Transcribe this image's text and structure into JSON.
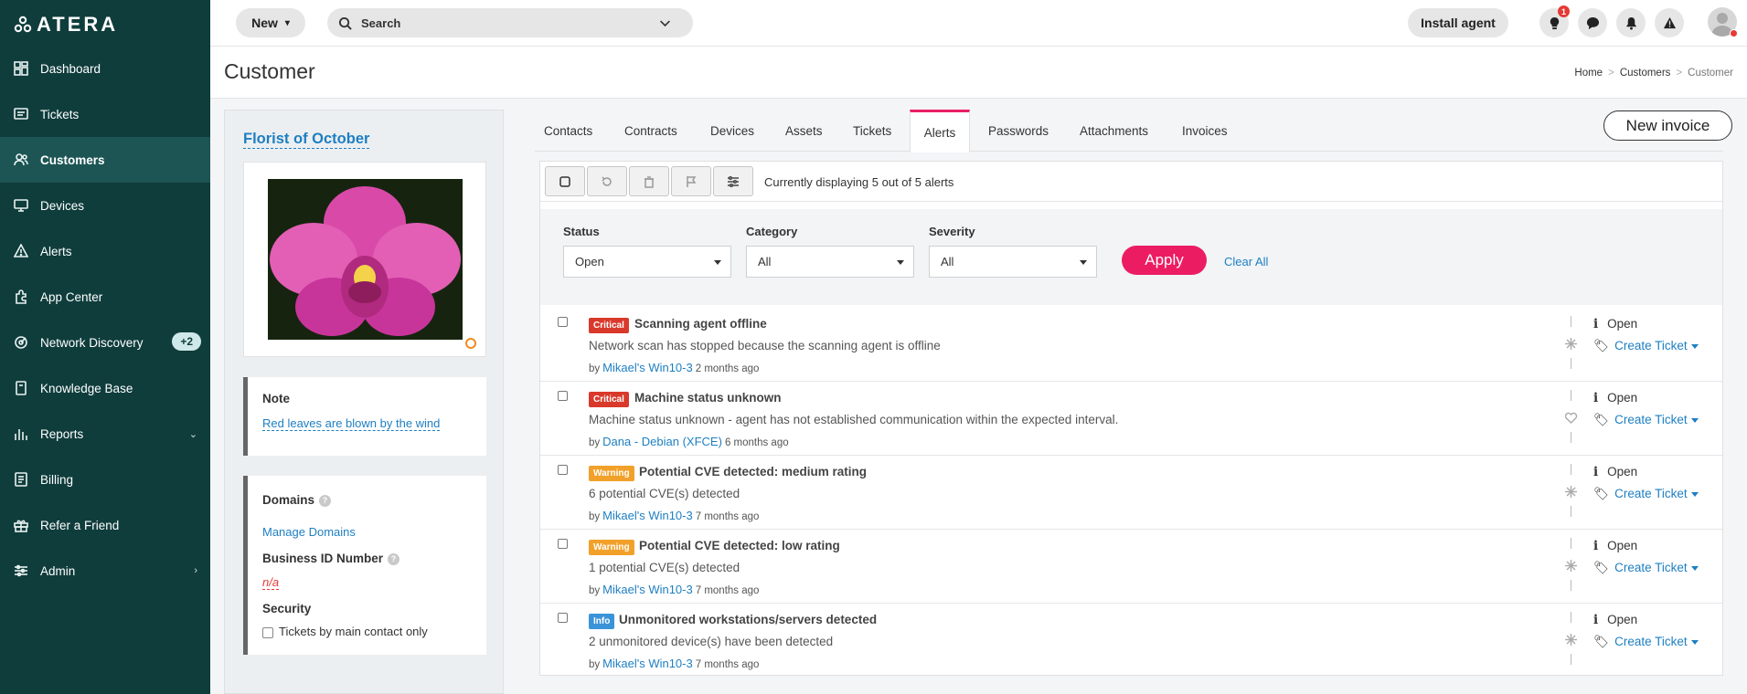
{
  "app": {
    "logo_text": "ATERA"
  },
  "sidebar": {
    "items": [
      {
        "label": "Dashboard",
        "icon": "dashboard-icon"
      },
      {
        "label": "Tickets",
        "icon": "tickets-icon"
      },
      {
        "label": "Customers",
        "icon": "customers-icon",
        "active": true
      },
      {
        "label": "Devices",
        "icon": "devices-icon"
      },
      {
        "label": "Alerts",
        "icon": "alerts-icon"
      },
      {
        "label": "App Center",
        "icon": "app-center-icon"
      },
      {
        "label": "Network Discovery",
        "icon": "network-discovery-icon",
        "badge": "+2"
      },
      {
        "label": "Knowledge Base",
        "icon": "knowledge-base-icon"
      },
      {
        "label": "Reports",
        "icon": "reports-icon",
        "chevron": "down"
      },
      {
        "label": "Billing",
        "icon": "billing-icon"
      },
      {
        "label": "Refer a Friend",
        "icon": "gift-icon"
      },
      {
        "label": "Admin",
        "icon": "admin-icon",
        "chevron": "right"
      }
    ]
  },
  "topbar": {
    "new_label": "New",
    "search_placeholder": "Search",
    "install_label": "Install agent",
    "notification_count": "1"
  },
  "page": {
    "title": "Customer",
    "breadcrumbs": [
      "Home",
      "Customers",
      "Customer"
    ]
  },
  "customer": {
    "name": "Florist of October",
    "note_label": "Note",
    "note_text": "Red leaves are blown by the wind",
    "domains_label": "Domains",
    "manage_domains": "Manage Domains",
    "business_id_label": "Business ID Number",
    "business_id_value": "n/a",
    "security_label": "Security",
    "security_option": "Tickets by main contact only"
  },
  "tabs": [
    "Contacts",
    "Contracts",
    "Devices",
    "Assets",
    "Tickets",
    "Alerts",
    "Passwords",
    "Attachments",
    "Invoices"
  ],
  "active_tab": "Alerts",
  "new_invoice_label": "New invoice",
  "alerts_panel": {
    "display_text": "Currently displaying 5 out of 5 alerts",
    "filters": {
      "status_label": "Status",
      "status_value": "Open",
      "category_label": "Category",
      "category_value": "All",
      "severity_label": "Severity",
      "severity_value": "All",
      "apply_label": "Apply",
      "clear_label": "Clear All"
    },
    "alerts": [
      {
        "severity": "Critical",
        "title": "Scanning agent offline",
        "description": "Network scan has stopped because the scanning agent is offline",
        "by": "by",
        "device": "Mikael's Win10-3",
        "time": "2 months ago",
        "status": "Open",
        "action": "Create Ticket"
      },
      {
        "severity": "Critical",
        "title": "Machine status unknown",
        "description": "Machine status unknown - agent has not established communication within the expected interval.",
        "by": "by",
        "device": "Dana - Debian (XFCE)",
        "time": "6 months ago",
        "status": "Open",
        "action": "Create Ticket"
      },
      {
        "severity": "Warning",
        "title": "Potential CVE detected: medium rating",
        "description": "6 potential CVE(s) detected",
        "by": "by",
        "device": "Mikael's Win10-3",
        "time": "7 months ago",
        "status": "Open",
        "action": "Create Ticket"
      },
      {
        "severity": "Warning",
        "title": "Potential CVE detected: low rating",
        "description": "1 potential CVE(s) detected",
        "by": "by",
        "device": "Mikael's Win10-3",
        "time": "7 months ago",
        "status": "Open",
        "action": "Create Ticket"
      },
      {
        "severity": "Info",
        "title": "Unmonitored workstations/servers detected",
        "description": "2 unmonitored device(s) have been detected",
        "by": "by",
        "device": "Mikael's Win10-3",
        "time": "7 months ago",
        "status": "Open",
        "action": "Create Ticket"
      }
    ]
  },
  "colors": {
    "sidebar": "#0f3d3c",
    "accent": "#ec1c63",
    "link": "#1e7fc2",
    "critical": "#d9392b",
    "warning": "#f1a12a",
    "info": "#3b93d8"
  }
}
